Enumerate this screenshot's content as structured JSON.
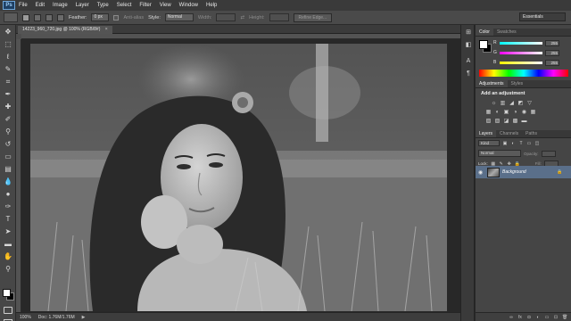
{
  "app": {
    "logo_text": "Ps"
  },
  "menu": [
    {
      "label": "File"
    },
    {
      "label": "Edit"
    },
    {
      "label": "Image"
    },
    {
      "label": "Layer"
    },
    {
      "label": "Type"
    },
    {
      "label": "Select"
    },
    {
      "label": "Filter"
    },
    {
      "label": "View"
    },
    {
      "label": "Window"
    },
    {
      "label": "Help"
    }
  ],
  "options": {
    "feather_label": "Feather:",
    "feather_value": "0 px",
    "antialias_label": "Anti-alias",
    "style_label": "Style:",
    "style_value": "Normal",
    "width_label": "Width:",
    "height_label": "Height:",
    "refine_edge": "Refine Edge...",
    "workspace": "Essentials"
  },
  "document": {
    "tab_label": "14223_960_720.jpg @ 100% (RGB/8#)",
    "tab_close": "×"
  },
  "status": {
    "zoom": "100%",
    "doc_size": "Doc: 1.76M/1.76M",
    "arrow": "▶"
  },
  "color_panel": {
    "tab_color": "Color",
    "tab_swatches": "Swatches",
    "r_label": "R",
    "g_label": "G",
    "b_label": "B",
    "r_value": "255",
    "g_value": "255",
    "b_value": "255"
  },
  "adjustments_panel": {
    "tab_adjustments": "Adjustments",
    "tab_styles": "Styles",
    "title": "Add an adjustment",
    "row1": [
      "☼",
      "▥",
      "◢",
      "◩",
      "▽"
    ],
    "row2": [
      "▦",
      "◐",
      "▣",
      "◑",
      "◉",
      "▦"
    ],
    "row3": [
      "▨",
      "▧",
      "◪",
      "▩",
      "▬"
    ]
  },
  "layers_panel": {
    "tab_layers": "Layers",
    "tab_channels": "Channels",
    "tab_paths": "Paths",
    "kind_value": "Kind",
    "blend_mode": "Normal",
    "opacity_label": "Opacity:",
    "lock_label": "Lock:",
    "fill_label": "Fill:",
    "layer_name": "Background"
  },
  "colors": {
    "accent_selected_layer": "#5a6f8a",
    "ui_dark": "#282828",
    "panel_bg": "#454545"
  }
}
